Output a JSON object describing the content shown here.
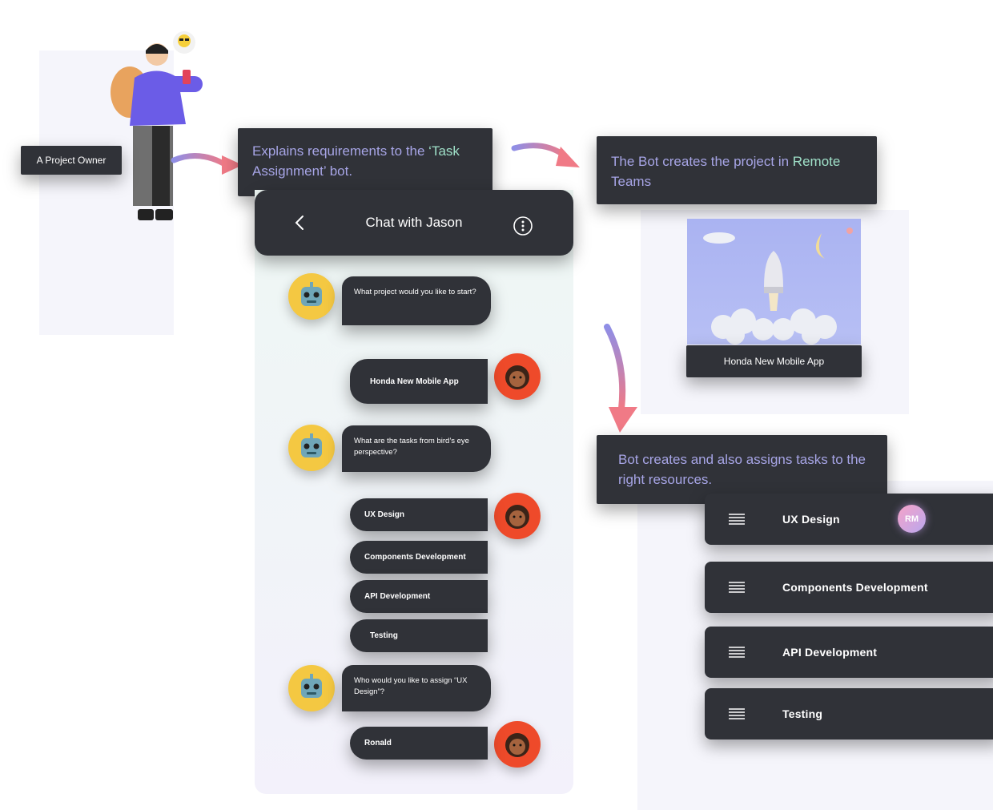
{
  "owner_label": "A Project Owner",
  "callout_1": {
    "before": "Explains requirements to the ",
    "highlight": "‘Task",
    "after": " Assignment’ bot."
  },
  "callout_2": {
    "before": "The Bot creates the project in ",
    "highlight": "Remote",
    "after": " Teams"
  },
  "callout_3": {
    "text": "Bot creates and also assigns tasks to the right resources."
  },
  "chat": {
    "title": "Chat with Jason",
    "back_icon": "chevron-left-icon",
    "more_icon": "more-vertical-icon",
    "messages": [
      {
        "from": "bot",
        "text": "What project would you like to start?"
      },
      {
        "from": "user",
        "text": "Honda New Mobile App"
      },
      {
        "from": "bot",
        "text": "What are the tasks from bird’s eye perspective?"
      },
      {
        "from": "user",
        "text": "UX Design"
      },
      {
        "from": "user",
        "text": "Components Development"
      },
      {
        "from": "user",
        "text": "API Development"
      },
      {
        "from": "user",
        "text": "Testing"
      },
      {
        "from": "bot",
        "text": "Who would you like to assign “UX Design”?"
      },
      {
        "from": "user",
        "text": "Ronald"
      }
    ]
  },
  "project_card": {
    "caption": "Honda New Mobile App"
  },
  "tasks": [
    {
      "label": "UX Design",
      "assignee": "RM"
    },
    {
      "label": "Components Development"
    },
    {
      "label": "API Development"
    },
    {
      "label": "Testing"
    }
  ],
  "colors": {
    "dark": "#303238",
    "accent_purple": "#a7a5e6",
    "accent_green": "#9fe0c8",
    "bot_yellow": "#f4c842",
    "user_red": "#ee4a2a"
  }
}
